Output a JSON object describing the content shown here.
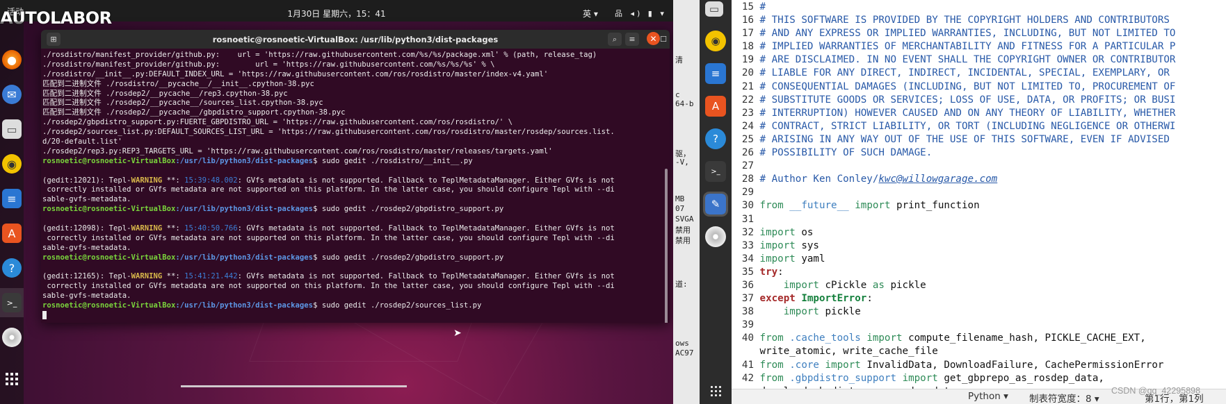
{
  "left_vm": {
    "overlay_logo": "AUTOLABOR",
    "topbar": {
      "activities": "活动",
      "clock": "1月30日 星期六，15：41",
      "ime": "英 ▾",
      "tray": "品 ◂) ▮ ▾"
    },
    "dock": [
      "firefox-icon",
      "thunderbird-icon",
      "files-icon",
      "rhythmbox-icon",
      "writer-icon",
      "software-icon",
      "help-icon",
      "terminal-icon",
      "dvd-icon",
      "apps-grid-icon"
    ],
    "terminal": {
      "title": "rosnoetic@rosnoetic-VirtualBox: /usr/lib/python3/dist-packages",
      "prompt_user": "rosnoetic@rosnoetic-VirtualBox",
      "prompt_path": ":/usr/lib/python3/dist-packages",
      "lines": [
        {
          "t": "plain",
          "text": "./rosdistro/manifest_provider/github.py:    url = 'https://raw.githubusercontent.com/%s/%s/package.xml' % (path, release_tag)"
        },
        {
          "t": "plain",
          "text": "./rosdistro/manifest_provider/github.py:        url = 'https://raw.githubusercontent.com/%s/%s/%s' % \\"
        },
        {
          "t": "plain",
          "text": "./rosdistro/__init__.py:DEFAULT_INDEX_URL = 'https://raw.githubusercontent.com/ros/rosdistro/master/index-v4.yaml'"
        },
        {
          "t": "plain",
          "text": "匹配到二进制文件 ./rosdistro/__pycache__/__init__.cpython-38.pyc"
        },
        {
          "t": "plain",
          "text": "匹配到二进制文件 ./rosdep2/__pycache__/rep3.cpython-38.pyc"
        },
        {
          "t": "plain",
          "text": "匹配到二进制文件 ./rosdep2/__pycache__/sources_list.cpython-38.pyc"
        },
        {
          "t": "plain",
          "text": "匹配到二进制文件 ./rosdep2/__pycache__/gbpdistro_support.cpython-38.pyc"
        },
        {
          "t": "plain",
          "text": "./rosdep2/gbpdistro_support.py:FUERTE_GBPDISTRO_URL = 'https://raw.githubusercontent.com/ros/rosdistro/' \\"
        },
        {
          "t": "plain",
          "text": "./rosdep2/sources_list.py:DEFAULT_SOURCES_LIST_URL = 'https://raw.githubusercontent.com/ros/rosdistro/master/rosdep/sources.list."
        },
        {
          "t": "plain",
          "text": "d/20-default.list'"
        },
        {
          "t": "plain",
          "text": "./rosdep2/rep3.py:REP3_TARGETS_URL = 'https://raw.githubusercontent.com/ros/rosdistro/master/releases/targets.yaml'"
        },
        {
          "t": "prompt",
          "cmd": "$ sudo gedit ./rosdistro/__init__.py"
        },
        {
          "t": "plain",
          "text": ""
        },
        {
          "t": "warn",
          "pre": "(gedit:12021): Tepl-",
          "warn": "WARNING",
          "mid": " **: ",
          "ts": "15:39:48.002",
          "post": ": GVfs metadata is not supported. Fallback to TeplMetadataManager. Either GVfs is not"
        },
        {
          "t": "plain",
          "text": " correctly installed or GVfs metadata are not supported on this platform. In the latter case, you should configure Tepl with --di"
        },
        {
          "t": "plain",
          "text": "sable-gvfs-metadata."
        },
        {
          "t": "prompt",
          "cmd": "$ sudo gedit ./rosdep2/gbpdistro_support.py"
        },
        {
          "t": "plain",
          "text": ""
        },
        {
          "t": "warn",
          "pre": "(gedit:12098): Tepl-",
          "warn": "WARNING",
          "mid": " **: ",
          "ts": "15:40:50.766",
          "post": ": GVfs metadata is not supported. Fallback to TeplMetadataManager. Either GVfs is not"
        },
        {
          "t": "plain",
          "text": " correctly installed or GVfs metadata are not supported on this platform. In the latter case, you should configure Tepl with --di"
        },
        {
          "t": "plain",
          "text": "sable-gvfs-metadata."
        },
        {
          "t": "prompt",
          "cmd": "$ sudo gedit ./rosdep2/gbpdistro_support.py"
        },
        {
          "t": "plain",
          "text": ""
        },
        {
          "t": "warn",
          "pre": "(gedit:12165): Tepl-",
          "warn": "WARNING",
          "mid": " **: ",
          "ts": "15:41:21.442",
          "post": ": GVfs metadata is not supported. Fallback to TeplMetadataManager. Either GVfs is not"
        },
        {
          "t": "plain",
          "text": " correctly installed or GVfs metadata are not supported on this platform. In the latter case, you should configure Tepl with --di"
        },
        {
          "t": "plain",
          "text": "sable-gvfs-metadata."
        },
        {
          "t": "prompt",
          "cmd": "$ sudo gedit ./rosdep2/sources_list.py"
        },
        {
          "t": "cursor"
        }
      ]
    }
  },
  "host_strip": {
    "fragments": [
      "清",
      "c",
      "64-b",
      "驱，",
      "-V,",
      "MB",
      "07",
      "SVGA",
      "禁用",
      "禁用",
      "道:",
      "ows",
      "AC97"
    ]
  },
  "editor": {
    "dock": [
      "panel-icon",
      "rhythmbox-icon",
      "writer-icon",
      "software-icon",
      "help-icon",
      "terminal-icon",
      "text-editor-icon",
      "dvd-icon"
    ],
    "lines": [
      {
        "n": "15",
        "segs": [
          [
            "cmt",
            "#"
          ]
        ]
      },
      {
        "n": "16",
        "segs": [
          [
            "cmt",
            "# THIS SOFTWARE IS PROVIDED BY THE COPYRIGHT HOLDERS AND CONTRIBUTORS"
          ]
        ]
      },
      {
        "n": "17",
        "segs": [
          [
            "cmt",
            "# AND ANY EXPRESS OR IMPLIED WARRANTIES, INCLUDING, BUT NOT LIMITED TO"
          ]
        ]
      },
      {
        "n": "18",
        "segs": [
          [
            "cmt",
            "# IMPLIED WARRANTIES OF MERCHANTABILITY AND FITNESS FOR A PARTICULAR P"
          ]
        ]
      },
      {
        "n": "19",
        "segs": [
          [
            "cmt",
            "# ARE DISCLAIMED. IN NO EVENT SHALL THE COPYRIGHT OWNER OR CONTRIBUTOR"
          ]
        ]
      },
      {
        "n": "20",
        "segs": [
          [
            "cmt",
            "# LIABLE FOR ANY DIRECT, INDIRECT, INCIDENTAL, SPECIAL, EXEMPLARY, OR"
          ]
        ]
      },
      {
        "n": "21",
        "segs": [
          [
            "cmt",
            "# CONSEQUENTIAL DAMAGES (INCLUDING, BUT NOT LIMITED TO, PROCUREMENT OF"
          ]
        ]
      },
      {
        "n": "22",
        "segs": [
          [
            "cmt",
            "# SUBSTITUTE GOODS OR SERVICES; LOSS OF USE, DATA, OR PROFITS; OR BUSI"
          ]
        ]
      },
      {
        "n": "23",
        "segs": [
          [
            "cmt",
            "# INTERRUPTION) HOWEVER CAUSED AND ON ANY THEORY OF LIABILITY, WHETHER"
          ]
        ]
      },
      {
        "n": "24",
        "segs": [
          [
            "cmt",
            "# CONTRACT, STRICT LIABILITY, OR TORT (INCLUDING NEGLIGENCE OR OTHERWI"
          ]
        ]
      },
      {
        "n": "25",
        "segs": [
          [
            "cmt",
            "# ARISING IN ANY WAY OUT OF THE USE OF THIS SOFTWARE, EVEN IF ADVISED"
          ]
        ]
      },
      {
        "n": "26",
        "segs": [
          [
            "cmt",
            "# POSSIBILITY OF SUCH DAMAGE."
          ]
        ]
      },
      {
        "n": "27",
        "segs": []
      },
      {
        "n": "28",
        "segs": [
          [
            "cmt",
            "# Author Ken Conley/"
          ],
          [
            "mail",
            "kwc@willowgarage.com"
          ]
        ]
      },
      {
        "n": "29",
        "segs": []
      },
      {
        "n": "30",
        "segs": [
          [
            "kw2",
            "from"
          ],
          [
            "id",
            " "
          ],
          [
            "mod",
            "__future__"
          ],
          [
            "id",
            " "
          ],
          [
            "kw2",
            "import"
          ],
          [
            "id",
            " print_function"
          ]
        ]
      },
      {
        "n": "31",
        "segs": []
      },
      {
        "n": "32",
        "segs": [
          [
            "kw2",
            "import"
          ],
          [
            "id",
            " os"
          ]
        ]
      },
      {
        "n": "33",
        "segs": [
          [
            "kw2",
            "import"
          ],
          [
            "id",
            " sys"
          ]
        ]
      },
      {
        "n": "34",
        "segs": [
          [
            "kw2",
            "import"
          ],
          [
            "id",
            " yaml"
          ]
        ]
      },
      {
        "n": "35",
        "segs": [
          [
            "kw",
            "try"
          ],
          [
            "id",
            ":"
          ]
        ]
      },
      {
        "n": "36",
        "segs": [
          [
            "id",
            "    "
          ],
          [
            "kw2",
            "import"
          ],
          [
            "id",
            " cPickle "
          ],
          [
            "kw2",
            "as"
          ],
          [
            "id",
            " pickle"
          ]
        ]
      },
      {
        "n": "37",
        "segs": [
          [
            "kw",
            "except"
          ],
          [
            "id",
            " "
          ],
          [
            "exc",
            "ImportError"
          ],
          [
            "id",
            ":"
          ]
        ]
      },
      {
        "n": "38",
        "segs": [
          [
            "id",
            "    "
          ],
          [
            "kw2",
            "import"
          ],
          [
            "id",
            " pickle"
          ]
        ]
      },
      {
        "n": "39",
        "segs": []
      },
      {
        "n": "40",
        "segs": [
          [
            "kw2",
            "from"
          ],
          [
            "id",
            " "
          ],
          [
            "mod",
            ".cache_tools"
          ],
          [
            "id",
            " "
          ],
          [
            "kw2",
            "import"
          ],
          [
            "id",
            " compute_filename_hash, PICKLE_CACHE_EXT,"
          ]
        ]
      },
      {
        "n": "",
        "segs": [
          [
            "id",
            "write_atomic, write_cache_file"
          ]
        ]
      },
      {
        "n": "41",
        "segs": [
          [
            "kw2",
            "from"
          ],
          [
            "id",
            " "
          ],
          [
            "mod",
            ".core"
          ],
          [
            "id",
            " "
          ],
          [
            "kw2",
            "import"
          ],
          [
            "id",
            " InvalidData, DownloadFailure, CachePermissionError"
          ]
        ]
      },
      {
        "n": "42",
        "segs": [
          [
            "kw2",
            "from"
          ],
          [
            "id",
            " "
          ],
          [
            "mod",
            ".gbpdistro_support"
          ],
          [
            "id",
            " "
          ],
          [
            "kw2",
            "import"
          ],
          [
            "id",
            " get_gbprepo_as_rosdep_data,"
          ]
        ]
      },
      {
        "n": "",
        "segs": [
          [
            "id",
            "download_gbpdistro_as_rosdep_data"
          ]
        ]
      }
    ],
    "status": {
      "language": "Python ▾",
      "tab_width": "制表符宽度：8 ▾",
      "position": "第1行，第1列"
    },
    "watermark": "CSDN @qq_42295898"
  }
}
